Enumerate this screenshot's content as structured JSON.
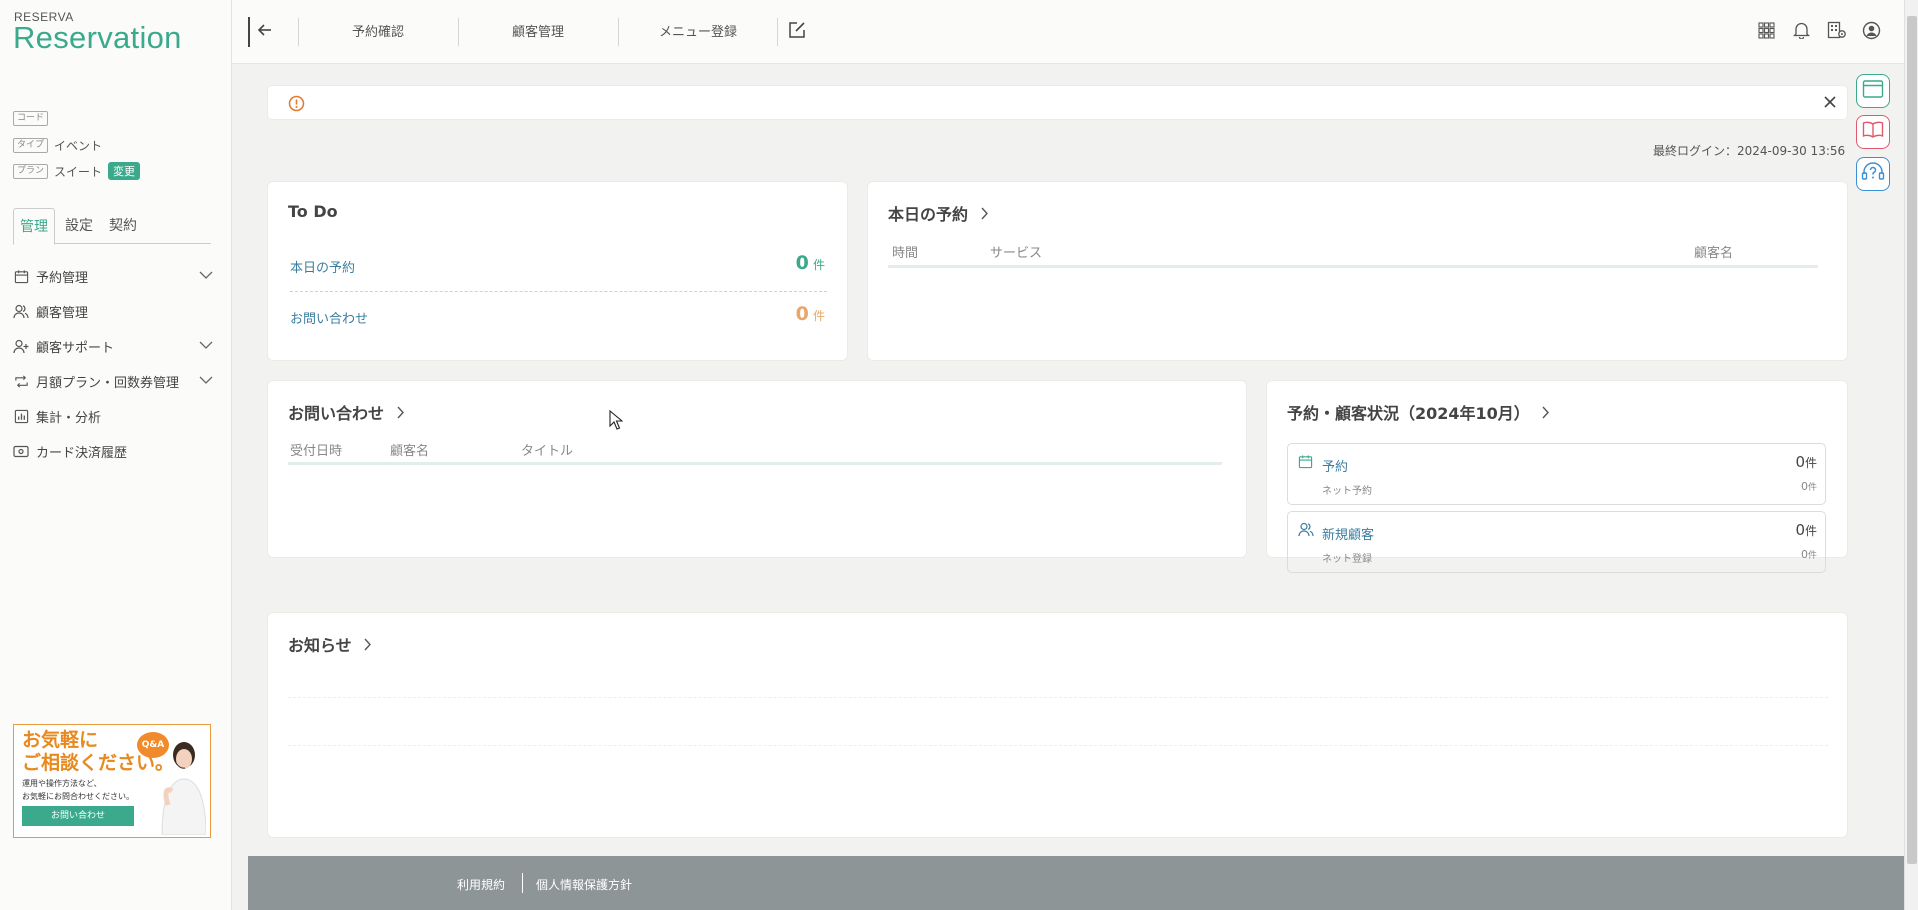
{
  "logo": {
    "small": "RESERVA",
    "big": "Reservation"
  },
  "meta": {
    "code_tag": "コード",
    "type_tag": "タイプ",
    "type_value": "イベント",
    "plan_tag": "プラン",
    "plan_value": "スイート",
    "change_label": "変更"
  },
  "side_tabs": [
    "管理",
    "設定",
    "契約"
  ],
  "nav": [
    {
      "label": "予約管理",
      "icon": "calendar-icon",
      "expandable": true
    },
    {
      "label": "顧客管理",
      "icon": "users-icon",
      "expandable": false
    },
    {
      "label": "顧客サポート",
      "icon": "user-plus-icon",
      "expandable": true
    },
    {
      "label": "月額プラン・回数券管理",
      "icon": "repeat-icon",
      "expandable": true
    },
    {
      "label": "集計・分析",
      "icon": "bar-chart-icon",
      "expandable": false
    },
    {
      "label": "カード決済履歴",
      "icon": "card-icon",
      "expandable": false
    }
  ],
  "banner": {
    "title_line1": "お気軽に",
    "title_line2": "ご相談ください。",
    "sub_line1": "運用や操作方法など、",
    "sub_line2": "お気軽にお問合わせください。",
    "button": "お問い合わせ",
    "badge": "Q&A"
  },
  "header": {
    "links": [
      "予約確認",
      "顧客管理",
      "メニュー登録"
    ]
  },
  "last_login": "最終ログイン：2024-09-30 13:56",
  "todo": {
    "title": "To Do",
    "rows": [
      {
        "label": "本日の予約",
        "count": "0",
        "unit": "件",
        "color": "#3aa98c"
      },
      {
        "label": "お問い合わせ",
        "count": "0",
        "unit": "件",
        "color": "#e8a66a"
      }
    ]
  },
  "today": {
    "title": "本日の予約",
    "columns": [
      "時間",
      "サービス",
      "顧客名"
    ]
  },
  "inquiries": {
    "title": "お問い合わせ",
    "columns": [
      "受付日時",
      "顧客名",
      "タイトル"
    ]
  },
  "status": {
    "title": "予約・顧客状況（2024年10月）",
    "items": [
      {
        "label": "予約",
        "count": "0",
        "unit": "件",
        "sub": "ネット予約",
        "sub_count": "0",
        "sub_unit": "件"
      },
      {
        "label": "新規顧客",
        "count": "0",
        "unit": "件",
        "sub": "ネット登録",
        "sub_count": "0",
        "sub_unit": "件"
      }
    ]
  },
  "news": {
    "title": "お知らせ"
  },
  "footer": {
    "terms": "利用規約",
    "privacy": "個人情報保護方針"
  },
  "colors": {
    "brand": "#3aa98c",
    "warning": "#e07a2c",
    "accent_orange": "#e8891f"
  }
}
